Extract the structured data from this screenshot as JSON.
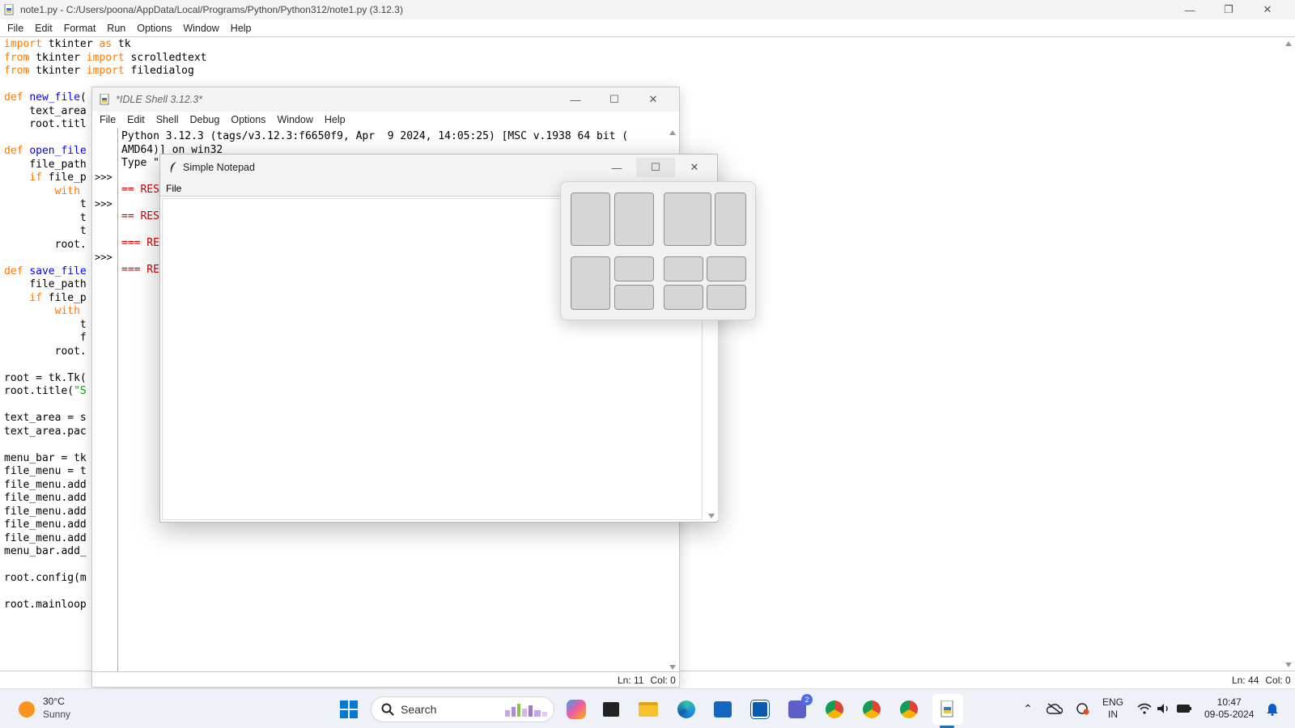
{
  "editor": {
    "title": "note1.py - C:/Users/poona/AppData/Local/Programs/Python/Python312/note1.py (3.12.3)",
    "menu": [
      "File",
      "Edit",
      "Format",
      "Run",
      "Options",
      "Window",
      "Help"
    ],
    "status": {
      "line": "Ln: 44",
      "col": "Col: 0"
    }
  },
  "shell": {
    "title": "*IDLE Shell 3.12.3*",
    "menu": [
      "File",
      "Edit",
      "Shell",
      "Debug",
      "Options",
      "Window",
      "Help"
    ],
    "prompt": ">>>",
    "lines": [
      "Python 3.12.3 (tags/v3.12.3:f6650f9, Apr  9 2024, 14:05:25) [MSC v.1938 64 bit (",
      "AMD64)] on win32",
      "Type \"",
      "",
      "== RES",
      "",
      "== RES",
      "",
      "=== RE",
      "",
      "=== RE"
    ],
    "status": {
      "line": "Ln: 11",
      "col": "Col: 0"
    }
  },
  "notepad": {
    "title": "Simple Notepad",
    "menu_file": "File"
  },
  "taskbar": {
    "weather_temp": "30°C",
    "weather_desc": "Sunny",
    "search_label": "Search",
    "teams_badge": "2",
    "lang": "ENG",
    "region": "IN",
    "time": "10:47",
    "date": "09-05-2024"
  },
  "colors": {
    "keyword": "#ff7700",
    "function_name": "#0000ff",
    "string": "#00aa00",
    "taskbar_bg": "#eef2f8",
    "windows_blue": "#0078d4"
  }
}
